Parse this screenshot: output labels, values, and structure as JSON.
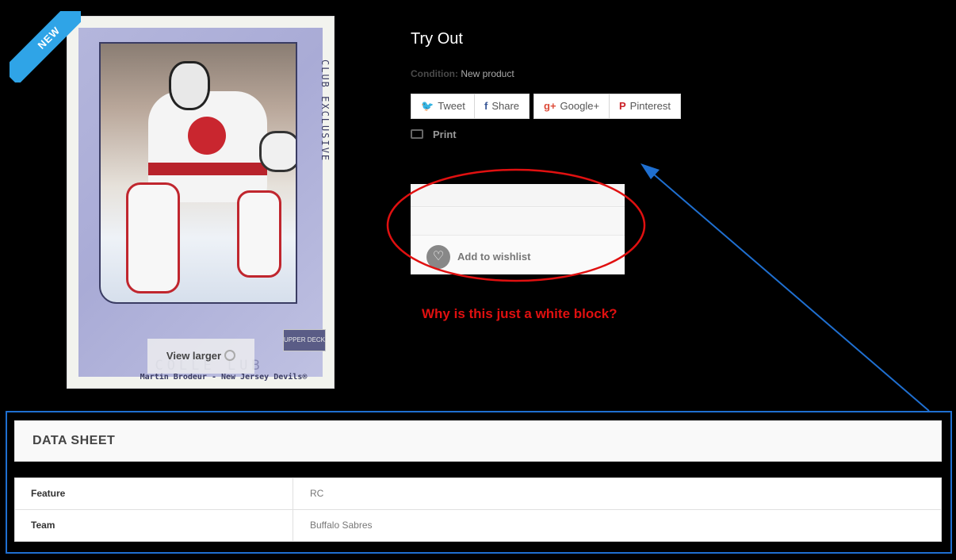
{
  "product": {
    "badge": "NEW",
    "title": "Try Out",
    "condition_label": "Condition:",
    "condition_value": "New product",
    "view_larger": "View larger",
    "card": {
      "side_text": "CLUB EXCLUSIVE",
      "ghost_title": "COLLE   LUB",
      "caption": "Martin Brodeur - New Jersey Devils®",
      "brand": "UPPER DECK"
    }
  },
  "share": [
    {
      "name": "tweet-button",
      "icon": "twitter-icon",
      "glyph": "🐦",
      "label": "Tweet",
      "color": "#1da1f2"
    },
    {
      "name": "share-button",
      "icon": "facebook-icon",
      "glyph": "f",
      "label": "Share",
      "color": "#3b5998"
    },
    {
      "name": "googleplus-button",
      "icon": "googleplus-icon",
      "glyph": "g+",
      "label": "Google+",
      "color": "#dd4b39"
    },
    {
      "name": "pinterest-button",
      "icon": "pinterest-icon",
      "glyph": "P",
      "label": "Pinterest",
      "color": "#cb2027"
    }
  ],
  "print_label": "Print",
  "wishlist_label": "Add to wishlist",
  "annotation": "Why is this just a white block?",
  "datasheet": {
    "title": "DATA SHEET",
    "rows": [
      {
        "key": "Feature",
        "value": "RC"
      },
      {
        "key": "Team",
        "value": "Buffalo Sabres"
      }
    ]
  },
  "colors": {
    "annotation": "#e01010",
    "highlight_blue": "#1f6fd0",
    "badge": "#2fa4e7"
  }
}
